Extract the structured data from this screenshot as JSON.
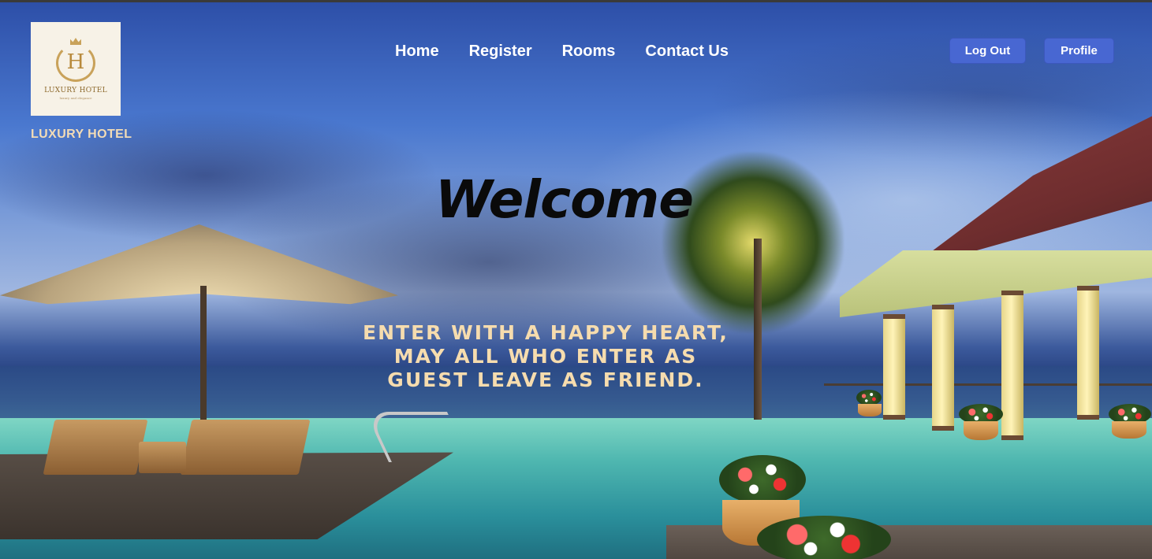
{
  "brand": {
    "logo_letter": "H",
    "logo_name": "LUXURY HOTEL",
    "logo_tagline": "luxury and elegance",
    "title": "LUXURY HOTEL"
  },
  "nav": {
    "items": [
      {
        "label": "Home"
      },
      {
        "label": "Register"
      },
      {
        "label": "Rooms"
      },
      {
        "label": "Contact Us"
      }
    ]
  },
  "account": {
    "logout_label": "Log Out",
    "profile_label": "Profile"
  },
  "hero": {
    "welcome": "Welcome",
    "quote_lines": [
      "ENTER WITH A HAPPY HEART,",
      "MAY ALL WHO ENTER AS",
      "GUEST LEAVE AS FRIEND."
    ]
  },
  "colors": {
    "button_bg": "#4867d2",
    "brand_text": "#f3dcb6",
    "quote_text": "#f6dcae",
    "logo_bg": "#f7f2e7"
  }
}
